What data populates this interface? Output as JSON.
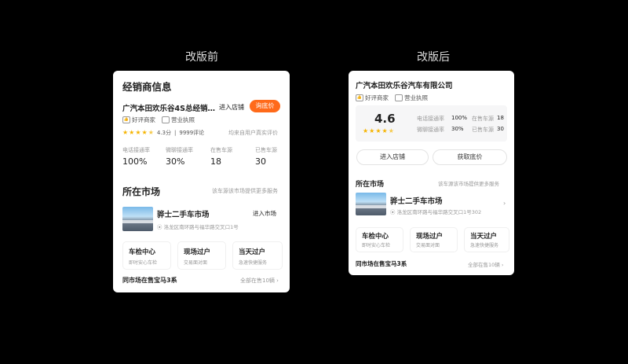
{
  "before": {
    "heading": "改版前",
    "title": "经销商信息",
    "dealer_name": "广汽本田欢乐谷4S总经销…",
    "enter_store": "进入店铺",
    "ask_price": "询底价",
    "tags": [
      "好评商家",
      "营业执照"
    ],
    "rating": 4.3,
    "rating_text": "4.3分",
    "review_count": "9999评论",
    "review_note": "均来自用户真实评价",
    "stats": [
      {
        "label": "电话接通率",
        "value": "100%"
      },
      {
        "label": "微聊接通率",
        "value": "30%"
      },
      {
        "label": "在售车源",
        "value": "18"
      },
      {
        "label": "已售车源",
        "value": "30"
      }
    ],
    "market_title": "所在市场",
    "market_more": "该车源该市场提供更多服务",
    "market_name": "骅士二手车市场",
    "market_enter": "进入市场",
    "market_address": "洛龙区南环路与福华路交叉口1号",
    "services": [
      {
        "title": "车检中心",
        "subtitle": "即时安心车检"
      },
      {
        "title": "现场过户",
        "subtitle": "交易面对面"
      },
      {
        "title": "当天过户",
        "subtitle": "急速快捷服务"
      }
    ],
    "same_market": "同市场在售宝马3系",
    "see_all": "全部在售10辆 ›"
  },
  "after": {
    "heading": "改版后",
    "dealer_name": "广汽本田欢乐谷汽车有限公司",
    "tags": [
      "好评商家",
      "营业执照"
    ],
    "score": "4.6",
    "rating": 4.6,
    "stats": [
      {
        "label": "电话接通率",
        "value": "100%"
      },
      {
        "label": "在售车源",
        "value": "18"
      },
      {
        "label": "微聊接通率",
        "value": "30%"
      },
      {
        "label": "已售车源",
        "value": "30"
      }
    ],
    "enter_store": "进入店铺",
    "ask_price": "获取底价",
    "market_title": "所在市场",
    "market_more": "该车源该市场提供更多服务",
    "market_name": "骅士二手车市场",
    "market_address": "洛龙区南环路与福华路交叉口1号302",
    "services": [
      {
        "title": "车检中心",
        "subtitle": "即时安心车检"
      },
      {
        "title": "现场过户",
        "subtitle": "交易面对面"
      },
      {
        "title": "当天过户",
        "subtitle": "急速快捷服务"
      }
    ],
    "same_market": "同市场在售宝马3系",
    "see_all": "全部在售10辆 ›"
  },
  "colors": {
    "accent": "#ff6a1a",
    "star": "#f5b400"
  }
}
